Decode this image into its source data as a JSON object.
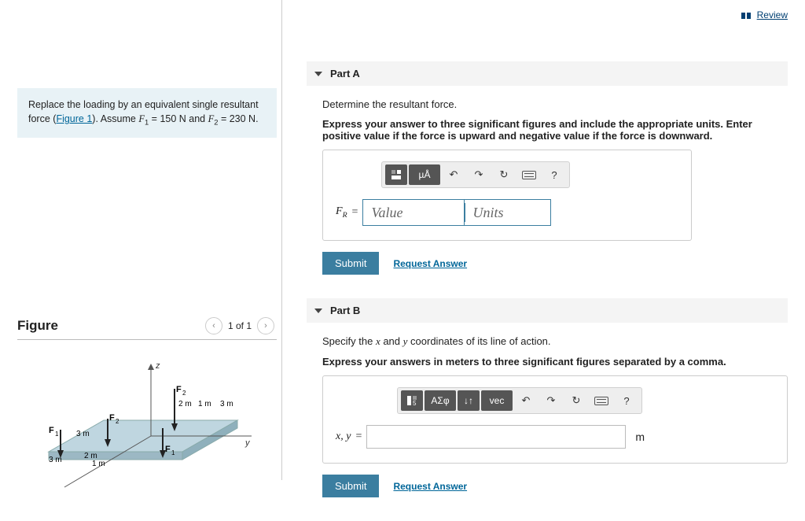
{
  "review_link": "Review",
  "problem": {
    "prefix": "Replace the loading by an equivalent single resultant force (",
    "figure_link": "Figure 1",
    "mid": "). Assume ",
    "F1_label": "F",
    "F1_sub": "1",
    "eq1": " = 150 N and ",
    "F2_label": "F",
    "F2_sub": "2",
    "eq2": " = 230 N."
  },
  "figure": {
    "title": "Figure",
    "count": "1 of 1",
    "labels": {
      "z": "z",
      "y": "y",
      "F1": "F",
      "F1s": "1",
      "F2": "F",
      "F2s": "2",
      "d3m": "3 m",
      "d2m": "2 m",
      "d1m": "1 m"
    }
  },
  "partA": {
    "title": "Part A",
    "line1": "Determine the resultant force.",
    "line2": "Express your answer to three significant figures and include the appropriate units. Enter positive value if the force is upward and negative value if the force is downward.",
    "toolbar": {
      "microA": "µÅ",
      "undo": "↶",
      "redo": "↷",
      "reset": "↻",
      "help": "?"
    },
    "var": "F",
    "varSub": "R",
    "eq": "=",
    "value_ph": "Value",
    "units_ph": "Units",
    "submit": "Submit",
    "request": "Request Answer"
  },
  "partB": {
    "title": "Part B",
    "line1_pre": "Specify the ",
    "x": "x",
    "line1_mid": " and ",
    "y": "y",
    "line1_post": " coordinates of its line of action.",
    "line2": "Express your answers in meters to three significant figures separated by a comma.",
    "toolbar": {
      "asigma": "ΑΣφ",
      "updown": "↓↑",
      "vec": "vec",
      "undo": "↶",
      "redo": "↷",
      "reset": "↻",
      "help": "?"
    },
    "var": "x, y",
    "eq": "=",
    "unit": "m",
    "submit": "Submit",
    "request": "Request Answer"
  }
}
